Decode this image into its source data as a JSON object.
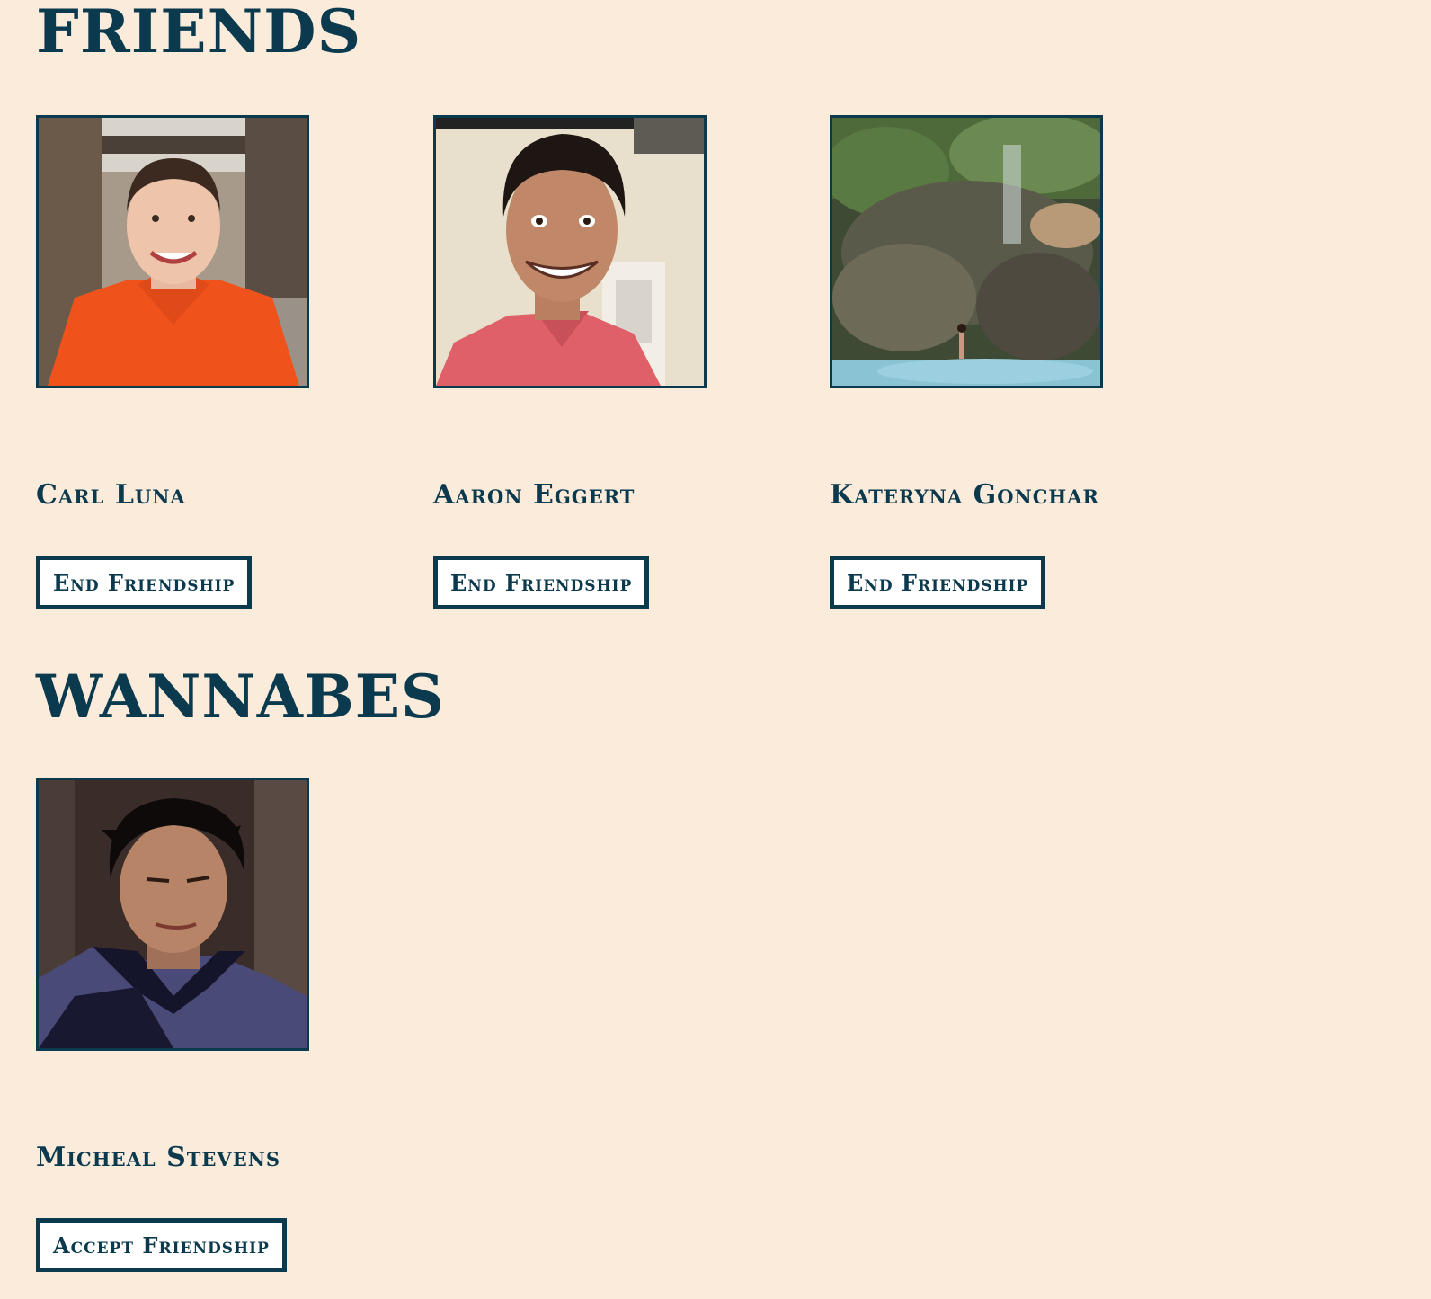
{
  "friends": {
    "title": "Friends",
    "people": [
      {
        "name": "Carl Luna",
        "button": "End Friendship",
        "photo": "photo-young-man-orange-jacket-street"
      },
      {
        "name": "Aaron Eggert",
        "button": "End Friendship",
        "photo": "photo-smiling-man-pink-shirt"
      },
      {
        "name": "Kateryna Gonchar",
        "button": "End Friendship",
        "photo": "photo-waterfall-rock-pool"
      }
    ]
  },
  "wannabes": {
    "title": "Wannabes",
    "people": [
      {
        "name": "Micheal Stevens",
        "button": "Accept Friendship",
        "photo": "photo-dark-haired-man-dark-shirt"
      }
    ]
  },
  "colors": {
    "background": "#faebdb",
    "accent": "#0b3a4e",
    "button_bg": "#ffffff"
  }
}
